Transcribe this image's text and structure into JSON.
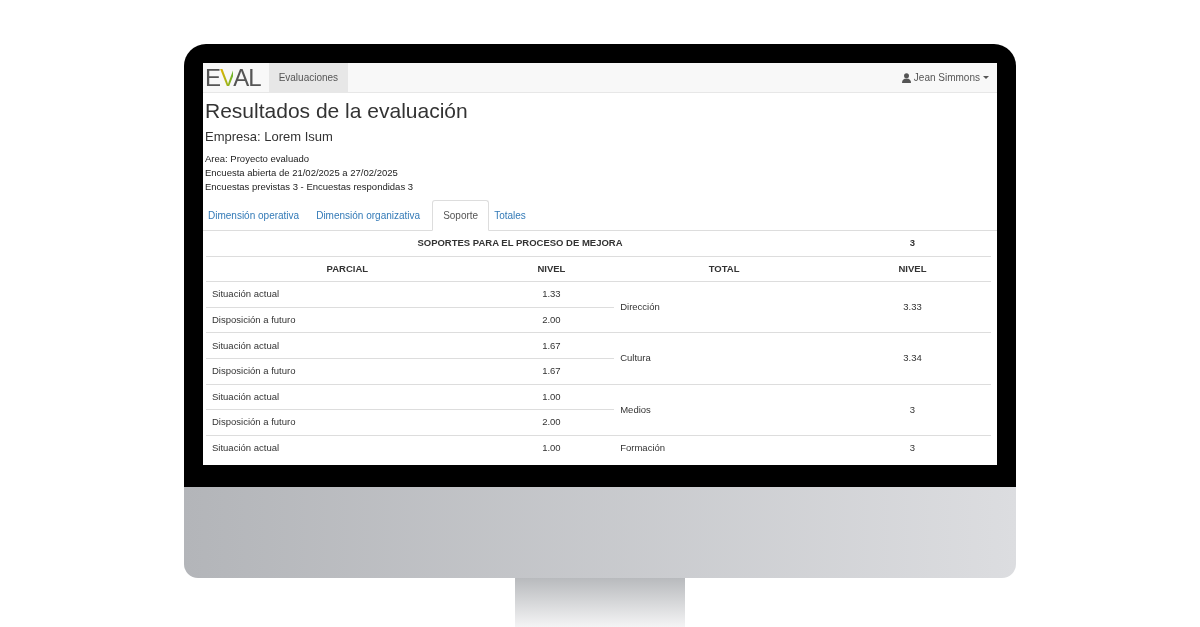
{
  "navbar": {
    "logo": "EVAL",
    "items": [
      {
        "label": "Evaluaciones",
        "selected": true
      }
    ],
    "user": "Jean Simmons"
  },
  "title": "Resultados de la evaluación",
  "company": "Empresa: Lorem Isum",
  "info": [
    "Area: Proyecto evaluado",
    "Encuesta abierta de 21/02/2025 a 27/02/2025",
    "Encuestas previstas 3 - Encuestas respondidas 3"
  ],
  "tabs": [
    {
      "label": "Dimensión operativa",
      "selected": false
    },
    {
      "label": "Dimensión organizativa",
      "selected": false
    },
    {
      "label": "Soporte",
      "selected": true
    },
    {
      "label": "Totales",
      "selected": false
    }
  ],
  "table": {
    "title": "SOPORTES PARA EL PROCESO DE MEJORA",
    "title_value": "3",
    "columns": [
      "PARCIAL",
      "NIVEL",
      "TOTAL",
      "NIVEL"
    ],
    "groups": [
      {
        "total": "Dirección",
        "level": "3.33",
        "partials": [
          {
            "name": "Situación actual",
            "value": "1.33"
          },
          {
            "name": "Disposición a futuro",
            "value": "2.00"
          }
        ]
      },
      {
        "total": "Cultura",
        "level": "3.34",
        "partials": [
          {
            "name": "Situación actual",
            "value": "1.67"
          },
          {
            "name": "Disposición a futuro",
            "value": "1.67"
          }
        ]
      },
      {
        "total": "Medios",
        "level": "3",
        "partials": [
          {
            "name": "Situación actual",
            "value": "1.00"
          },
          {
            "name": "Disposición a futuro",
            "value": "2.00"
          }
        ]
      },
      {
        "total": "Formación",
        "level": "3",
        "partials": [
          {
            "name": "Situación actual",
            "value": "1.00"
          }
        ]
      }
    ]
  }
}
